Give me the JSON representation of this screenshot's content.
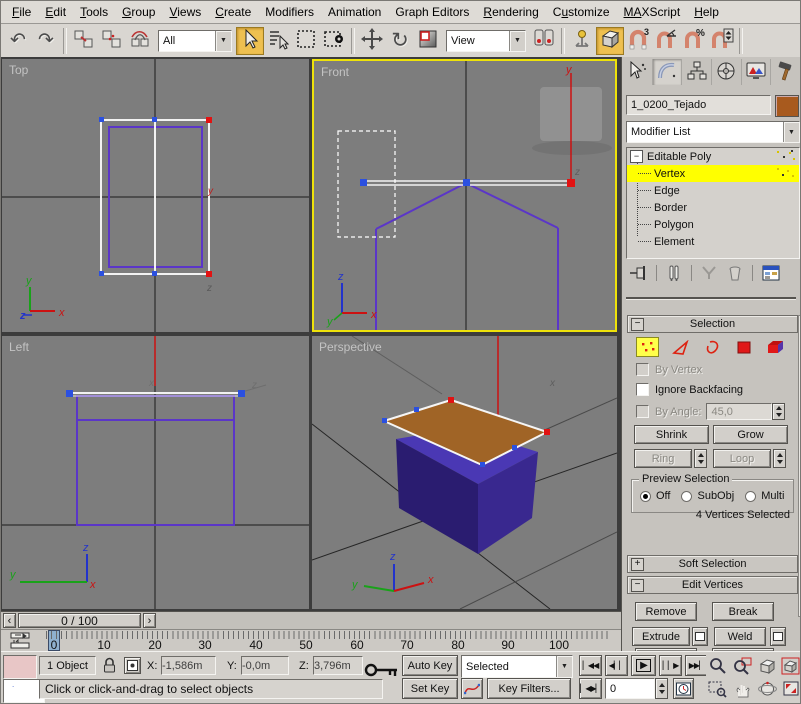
{
  "menu": {
    "items": [
      {
        "pre": "",
        "accel": "F",
        "post": "ile"
      },
      {
        "pre": "",
        "accel": "E",
        "post": "dit"
      },
      {
        "pre": "",
        "accel": "T",
        "post": "ools"
      },
      {
        "pre": "",
        "accel": "G",
        "post": "roup"
      },
      {
        "pre": "",
        "accel": "V",
        "post": "iews"
      },
      {
        "pre": "",
        "accel": "C",
        "post": "reate"
      },
      {
        "pre": "Modifiers",
        "accel": "",
        "post": ""
      },
      {
        "pre": "Animation",
        "accel": "",
        "post": ""
      },
      {
        "pre": "Graph Editors",
        "accel": "",
        "post": ""
      },
      {
        "pre": "",
        "accel": "R",
        "post": "endering"
      },
      {
        "pre": "C",
        "accel": "u",
        "post": "stomize"
      },
      {
        "pre": "",
        "accel": "MA",
        "post": "XScript"
      },
      {
        "pre": "",
        "accel": "H",
        "post": "elp"
      }
    ]
  },
  "toolbar": {
    "filter_value": "All",
    "view_value": "View"
  },
  "viewports": {
    "top_label": "Top",
    "front_label": "Front",
    "left_label": "Left",
    "perspective_label": "Perspective",
    "viewport_bg": "#7d7d7d",
    "active_border": "#eee20a",
    "wire_color": "#5b36c8",
    "selected_vertex_color": "#e21212",
    "vertex_color": "#2b50e0",
    "roof_color": "#a06426"
  },
  "command_panel": {
    "object_name": "1_0200_Tejado",
    "object_color": "#a85a1e",
    "modifier_list_label": "Modifier List",
    "stack": {
      "root": "Editable Poly",
      "items": [
        "Vertex",
        "Edge",
        "Border",
        "Polygon",
        "Element"
      ],
      "selected": "Vertex",
      "highlight_color": "#ffff00"
    },
    "selection": {
      "title": "Selection",
      "by_vertex": "By Vertex",
      "ignore_backfacing": "Ignore Backfacing",
      "by_angle": "By Angle:",
      "angle_value": "45,0",
      "shrink": "Shrink",
      "grow": "Grow",
      "ring": "Ring",
      "loop": "Loop",
      "preview_title": "Preview Selection",
      "preview_options": [
        "Off",
        "SubObj",
        "Multi"
      ],
      "preview_selected": "Off",
      "status": "4 Vertices Selected"
    },
    "soft_selection_title": "Soft Selection",
    "edit_vertices": {
      "title": "Edit Vertices",
      "remove": "Remove",
      "break_label": "Break",
      "extrude": "Extrude",
      "weld": "Weld"
    }
  },
  "timeline": {
    "slider": "0 / 100",
    "ticks": [
      "0",
      "10",
      "20",
      "30",
      "40",
      "50",
      "60",
      "70",
      "80",
      "90",
      "100"
    ]
  },
  "status_bar": {
    "object_count": "1 Object",
    "x_label": "X:",
    "x_value": "-1,586m",
    "y_label": "Y:",
    "y_value": "-0,0m",
    "z_label": "Z:",
    "z_value": "3,796m",
    "prompt": "Click or click-and-drag to select objects",
    "auto_key": "Auto Key",
    "set_key": "Set Key",
    "selection_set": "Selected",
    "key_filters": "Key Filters...",
    "frame_value": "0"
  }
}
